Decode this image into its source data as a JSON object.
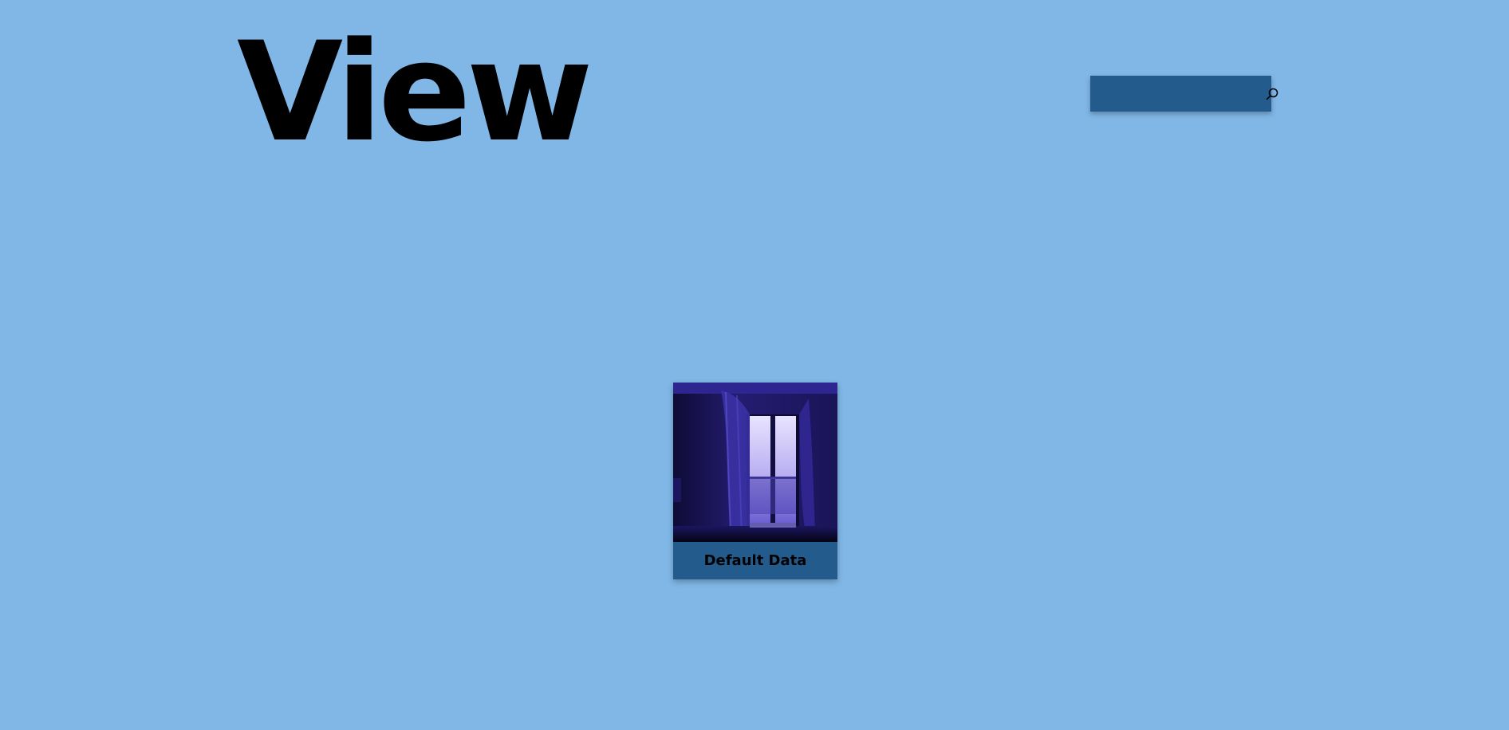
{
  "colors": {
    "background": "#80b7e6",
    "accent": "#245b8d",
    "text": "#000000"
  },
  "header": {
    "title": "View"
  },
  "search": {
    "placeholder": "",
    "value": "",
    "icon": "search-icon"
  },
  "items": [
    {
      "label": "Default Data",
      "thumbnail_icon": "window-curtains-image"
    }
  ]
}
